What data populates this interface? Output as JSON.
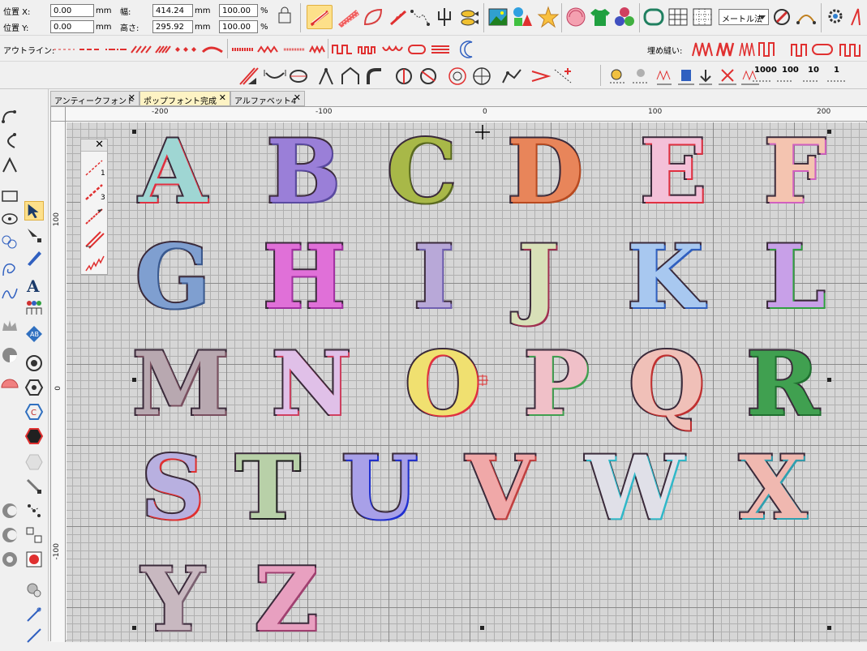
{
  "toolbar_top": {
    "pos_x_label": "位置 X:",
    "pos_y_label": "位置 Y:",
    "pos_x_value": "0.00",
    "pos_y_value": "0.00",
    "unit_mm": "mm",
    "width_label": "幅:",
    "height_label": "高さ:",
    "width_value": "414.24",
    "height_value": "295.92",
    "scale_w": "100.00",
    "scale_h": "100.00",
    "percent": "%",
    "method_combo": "メートル法"
  },
  "toolbar_outline": {
    "outline_label": "アウトライン:",
    "fill_stitch_label": "埋め縫い:",
    "count_labels": [
      "1000",
      "100",
      "10",
      "1"
    ]
  },
  "tabs": [
    {
      "label": "アンティークフォント",
      "active": false
    },
    {
      "label": "ポップフォント完成",
      "active": true
    },
    {
      "label": "アルファベット4",
      "active": false
    }
  ],
  "rulers": {
    "h_ticks": [
      "-200",
      "-100",
      "0",
      "100",
      "200"
    ],
    "v_ticks": [
      "100",
      "0",
      "-100"
    ]
  },
  "palette_labels": [
    "1",
    "3"
  ],
  "letters": [
    {
      "char": "A",
      "fill": "#9fd6d3",
      "accent": "#e03040"
    },
    {
      "char": "B",
      "fill": "#9a7fd8",
      "accent": "#5a4aa0"
    },
    {
      "char": "C",
      "fill": "#a8b848",
      "accent": "#5a6a20"
    },
    {
      "char": "D",
      "fill": "#e8855a",
      "accent": "#b84a20"
    },
    {
      "char": "E",
      "fill": "#f4c0d8",
      "accent": "#e03040"
    },
    {
      "char": "F",
      "fill": "#f4c4b0",
      "accent": "#d060c0"
    },
    {
      "char": "G",
      "fill": "#7f9fd0",
      "accent": "#3a5a90"
    },
    {
      "char": "H",
      "fill": "#e070d8",
      "accent": "#a030a0"
    },
    {
      "char": "I",
      "fill": "#b8a8d8",
      "accent": "#7060b0"
    },
    {
      "char": "J",
      "fill": "#d8e0b8",
      "accent": "#a03050"
    },
    {
      "char": "K",
      "fill": "#a8c8f0",
      "accent": "#3060c0"
    },
    {
      "char": "L",
      "fill": "#c8a0e8",
      "accent": "#30a040"
    },
    {
      "char": "M",
      "fill": "#b8a8b0",
      "accent": "#7a5060"
    },
    {
      "char": "N",
      "fill": "#e0c0e8",
      "accent": "#d04060"
    },
    {
      "char": "O",
      "fill": "#f0e070",
      "accent": "#e03040"
    },
    {
      "char": "P",
      "fill": "#f0c0c8",
      "accent": "#40a050"
    },
    {
      "char": "Q",
      "fill": "#f0c0b8",
      "accent": "#c03030"
    },
    {
      "char": "R",
      "fill": "#40a050",
      "accent": "#207030"
    },
    {
      "char": "S",
      "fill": "#b8b0e0",
      "accent": "#e03030"
    },
    {
      "char": "T",
      "fill": "#b8d0a8",
      "accent": "#202020"
    },
    {
      "char": "U",
      "fill": "#a8a0e8",
      "accent": "#2030d0"
    },
    {
      "char": "V",
      "fill": "#f0a8a8",
      "accent": "#c04040"
    },
    {
      "char": "W",
      "fill": "#e0e0e8",
      "accent": "#30b8c8"
    },
    {
      "char": "X",
      "fill": "#f0b8b0",
      "accent": "#30a0b0"
    },
    {
      "char": "Y",
      "fill": "#c8b8c0",
      "accent": "#7a6070"
    },
    {
      "char": "Z",
      "fill": "#e8a0c0",
      "accent": "#a04070"
    }
  ],
  "colors": {
    "active_tool": "#fde08a",
    "grid_bg": "#d6d6d6",
    "outline_red": "#d82020"
  }
}
